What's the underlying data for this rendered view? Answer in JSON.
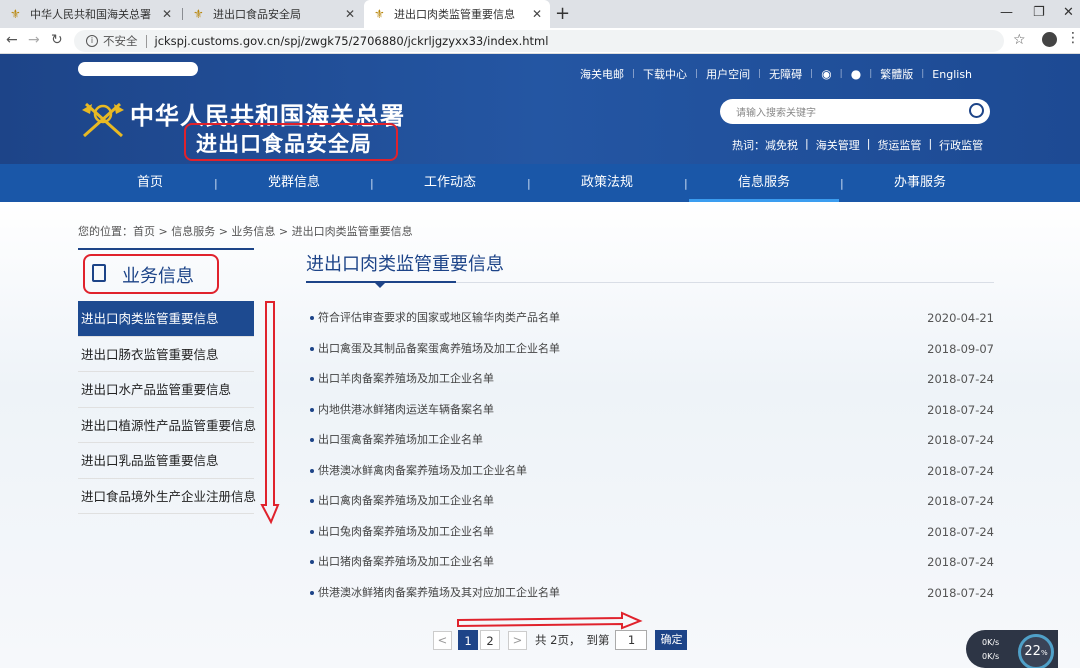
{
  "browser": {
    "tabs": [
      {
        "title": "中华人民共和国海关总署"
      },
      {
        "title": "进出口食品安全局"
      },
      {
        "title": "进出口肉类监管重要信息"
      }
    ],
    "security_label": "不安全",
    "url": "jckspj.customs.gov.cn/spj/zwgk75/2706880/jckrljgzyxx33/index.html"
  },
  "header": {
    "title": "中华人民共和国海关总署",
    "subtitle": "进出口食品安全局",
    "top_links": [
      "海关电邮",
      "下载中心",
      "用户空间",
      "无障碍",
      "繁體版",
      "English"
    ],
    "search_placeholder": "请输入搜索关键字",
    "hot_label": "热词：",
    "hot_words": [
      "减免税",
      "海关管理",
      "货运监管",
      "行政监管"
    ]
  },
  "nav": {
    "items": [
      {
        "label": "首页"
      },
      {
        "label": "党群信息"
      },
      {
        "label": "工作动态"
      },
      {
        "label": "政策法规"
      },
      {
        "label": "信息服务"
      },
      {
        "label": "办事服务"
      }
    ],
    "active": "信息服务"
  },
  "breadcrumb": "您的位置：首页 > 信息服务 > 业务信息 > 进出口肉类监管重要信息",
  "sidebar": {
    "title": "业务信息",
    "items": [
      {
        "label": "进出口肉类监管重要信息"
      },
      {
        "label": "进出口肠衣监管重要信息"
      },
      {
        "label": "进出口水产品监管重要信息"
      },
      {
        "label": "进出口植源性产品监管重要信息"
      },
      {
        "label": "进出口乳品监管重要信息"
      },
      {
        "label": "进口食品境外生产企业注册信息"
      }
    ]
  },
  "main": {
    "title": "进出口肉类监管重要信息",
    "list": [
      {
        "title": "符合评估审查要求的国家或地区输华肉类产品名单",
        "date": "2020-04-21"
      },
      {
        "title": "出口禽蛋及其制品备案蛋禽养殖场及加工企业名单",
        "date": "2018-09-07"
      },
      {
        "title": "出口羊肉备案养殖场及加工企业名单",
        "date": "2018-07-24"
      },
      {
        "title": "内地供港冰鲜猪肉运送车辆备案名单",
        "date": "2018-07-24"
      },
      {
        "title": "出口蛋禽备案养殖场加工企业名单",
        "date": "2018-07-24"
      },
      {
        "title": "供港澳冰鲜禽肉备案养殖场及加工企业名单",
        "date": "2018-07-24"
      },
      {
        "title": "出口禽肉备案养殖场及加工企业名单",
        "date": "2018-07-24"
      },
      {
        "title": "出口兔肉备案养殖场及加工企业名单",
        "date": "2018-07-24"
      },
      {
        "title": "出口猪肉备案养殖场及加工企业名单",
        "date": "2018-07-24"
      },
      {
        "title": "供港澳冰鲜猪肉备案养殖场及其对应加工企业名单",
        "date": "2018-07-24"
      }
    ]
  },
  "pager": {
    "prev": "<",
    "pages": [
      "1",
      "2"
    ],
    "next": ">",
    "total_text": "共 2页，",
    "goto_label": "到第",
    "goto_value": "1",
    "confirm": "确定"
  },
  "speed_widget": {
    "up": "0K/s",
    "down": "0K/s",
    "percent": "22"
  },
  "colors": {
    "header": "#1d4488",
    "nav": "#1a57a8",
    "annotation": "#e0222c"
  }
}
